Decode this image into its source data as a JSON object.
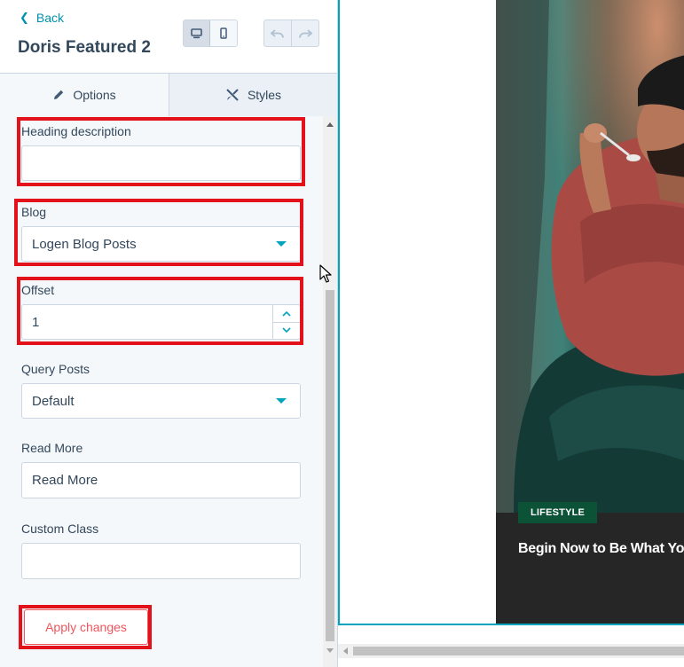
{
  "header": {
    "back_label": "Back",
    "title": "Doris Featured 2",
    "device_buttons": [
      {
        "icon": "desktop-icon",
        "active": true
      },
      {
        "icon": "mobile-icon",
        "active": false
      }
    ],
    "history_buttons": [
      {
        "icon": "undo-icon"
      },
      {
        "icon": "redo-icon"
      }
    ]
  },
  "tabs": [
    {
      "label": "Options",
      "icon": "pencil-icon",
      "active": true
    },
    {
      "label": "Styles",
      "icon": "brush-icon",
      "active": false
    }
  ],
  "form": {
    "heading_description": {
      "label": "Heading description",
      "value": ""
    },
    "blog": {
      "label": "Blog",
      "value": "Logen Blog Posts"
    },
    "offset": {
      "label": "Offset",
      "value": "1"
    },
    "query_posts": {
      "label": "Query Posts",
      "value": "Default"
    },
    "read_more": {
      "label": "Read More",
      "value": "Read More"
    },
    "custom_class": {
      "label": "Custom Class",
      "value": ""
    },
    "apply_label": "Apply changes"
  },
  "preview": {
    "badge": "LIFESTYLE",
    "post_title": "Begin Now to Be What Yo"
  },
  "colors": {
    "accent": "#00a4bd",
    "highlight": "#e3121a",
    "apply": "#f2545b",
    "badge": "#0b5236"
  }
}
